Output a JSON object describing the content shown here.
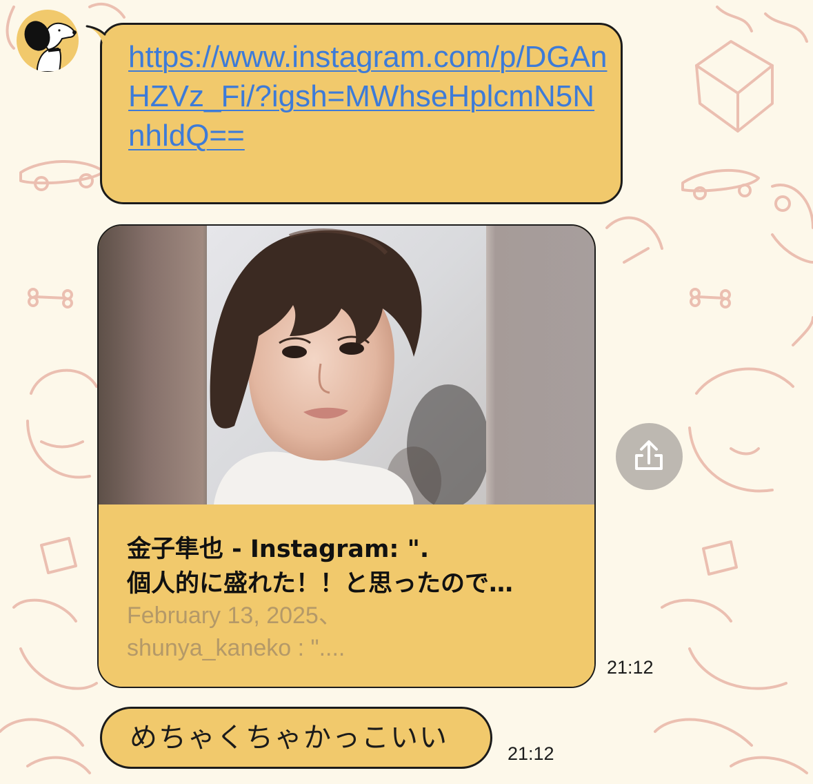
{
  "chat": {
    "messages": [
      {
        "type": "link",
        "text": "https://www.instagram.com/p/DGAnHZVz_Fi/?igsh=MWhseHplcmN5NnhldQ=="
      },
      {
        "type": "link_preview",
        "title": "金子隼也 - Instagram: \".\n個人的に盛れた！！と思ったので…",
        "description": "February 13, 2025、\nshunya_kaneko : \"....",
        "time": "21:12"
      },
      {
        "type": "text",
        "text": "めちゃくちゃかっこいい",
        "time": "21:12"
      }
    ]
  },
  "icons": {
    "avatar": "snoopy-avatar-icon",
    "share": "share-icon"
  },
  "colors": {
    "bubble": "#f1c96c",
    "link": "#3d7bd8",
    "wallpaper": "#fdf8ea",
    "doodle": "#eab9ab",
    "subtext": "#b49968"
  }
}
